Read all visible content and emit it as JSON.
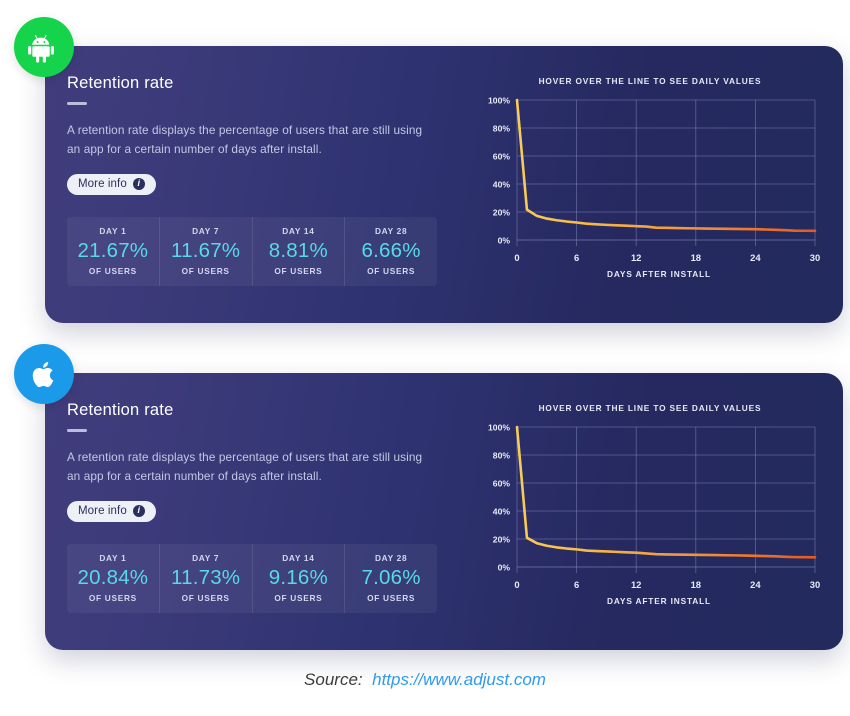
{
  "cards": [
    {
      "platform": "android",
      "platform_icon": "android-robot-icon",
      "badge_color": "#15d44b",
      "title": "Retention rate",
      "description": "A retention rate displays the percentage of users that are still using an app for a certain number of days after install.",
      "more_info_label": "More info",
      "more_info_icon": "info-circle-icon",
      "stats": [
        {
          "day": "DAY 1",
          "value": "21.67%",
          "sub": "OF USERS"
        },
        {
          "day": "DAY 7",
          "value": "11.67%",
          "sub": "OF USERS"
        },
        {
          "day": "DAY 14",
          "value": "8.81%",
          "sub": "OF USERS"
        },
        {
          "day": "DAY 28",
          "value": "6.66%",
          "sub": "OF USERS"
        }
      ],
      "chart_hint": "HOVER OVER THE LINE TO SEE DAILY VALUES",
      "chart_xlabel": "DAYS AFTER INSTALL"
    },
    {
      "platform": "ios",
      "platform_icon": "apple-logo-icon",
      "badge_color": "#1a9ae8",
      "title": "Retention rate",
      "description": "A retention rate displays the percentage of users that are still using an app for a certain number of days after install.",
      "more_info_label": "More info",
      "more_info_icon": "info-circle-icon",
      "stats": [
        {
          "day": "DAY 1",
          "value": "20.84%",
          "sub": "OF USERS"
        },
        {
          "day": "DAY 7",
          "value": "11.73%",
          "sub": "OF USERS"
        },
        {
          "day": "DAY 14",
          "value": "9.16%",
          "sub": "OF USERS"
        },
        {
          "day": "DAY 28",
          "value": "7.06%",
          "sub": "OF USERS"
        }
      ],
      "chart_hint": "HOVER OVER THE LINE TO SEE DAILY VALUES",
      "chart_xlabel": "DAYS AFTER INSTALL"
    }
  ],
  "source": {
    "label": "Source:",
    "url": "https://www.adjust.com"
  },
  "colors": {
    "accent_value": "#58d9e8",
    "line_start": "#f7c14a",
    "line_end": "#e8571f",
    "card_gradient_start": "#413d7d",
    "card_gradient_end": "#222a5e",
    "android_green": "#15d44b",
    "ios_blue": "#1a9ae8",
    "link_blue": "#2f9bf0"
  },
  "chart_data": [
    {
      "type": "line",
      "title": "HOVER OVER THE LINE TO SEE DAILY VALUES",
      "xlabel": "DAYS AFTER INSTALL",
      "ylabel": "",
      "xlim": [
        0,
        30
      ],
      "ylim": [
        0,
        100
      ],
      "xticks": [
        0,
        6,
        12,
        18,
        24,
        30
      ],
      "xtick_labels": [
        "0",
        "6",
        "12",
        "18",
        "24",
        "30"
      ],
      "yticks": [
        0,
        20,
        40,
        60,
        80,
        100
      ],
      "ytick_labels": [
        "0%",
        "20%",
        "40%",
        "60%",
        "80%",
        "100%"
      ],
      "grid": true,
      "legend": "none",
      "series": [
        {
          "name": "Android retention",
          "x": [
            0,
            1,
            2,
            3,
            4,
            5,
            6,
            7,
            8,
            9,
            10,
            11,
            12,
            13,
            14,
            15,
            16,
            17,
            18,
            19,
            20,
            21,
            22,
            23,
            24,
            25,
            26,
            27,
            28,
            29,
            30
          ],
          "values": [
            100,
            21.67,
            17.2,
            15.3,
            14.1,
            13.2,
            12.5,
            11.67,
            11.2,
            10.8,
            10.5,
            10.2,
            9.9,
            9.6,
            8.81,
            8.7,
            8.55,
            8.4,
            8.3,
            8.2,
            8.1,
            8.0,
            7.9,
            7.8,
            7.7,
            7.5,
            7.3,
            7.0,
            6.66,
            6.6,
            6.55
          ]
        }
      ]
    },
    {
      "type": "line",
      "title": "HOVER OVER THE LINE TO SEE DAILY VALUES",
      "xlabel": "DAYS AFTER INSTALL",
      "ylabel": "",
      "xlim": [
        0,
        30
      ],
      "ylim": [
        0,
        100
      ],
      "xticks": [
        0,
        6,
        12,
        18,
        24,
        30
      ],
      "xtick_labels": [
        "0",
        "6",
        "12",
        "18",
        "24",
        "30"
      ],
      "yticks": [
        0,
        20,
        40,
        60,
        80,
        100
      ],
      "ytick_labels": [
        "0%",
        "20%",
        "40%",
        "60%",
        "80%",
        "100%"
      ],
      "grid": true,
      "legend": "none",
      "series": [
        {
          "name": "iOS retention",
          "x": [
            0,
            1,
            2,
            3,
            4,
            5,
            6,
            7,
            8,
            9,
            10,
            11,
            12,
            13,
            14,
            15,
            16,
            17,
            18,
            19,
            20,
            21,
            22,
            23,
            24,
            25,
            26,
            27,
            28,
            29,
            30
          ],
          "values": [
            100,
            20.84,
            17.0,
            15.2,
            14.0,
            13.2,
            12.6,
            11.73,
            11.4,
            11.1,
            10.8,
            10.5,
            10.2,
            9.7,
            9.16,
            9.0,
            8.9,
            8.8,
            8.7,
            8.6,
            8.5,
            8.4,
            8.3,
            8.2,
            8.0,
            7.8,
            7.6,
            7.3,
            7.06,
            7.0,
            6.95
          ]
        }
      ]
    }
  ]
}
